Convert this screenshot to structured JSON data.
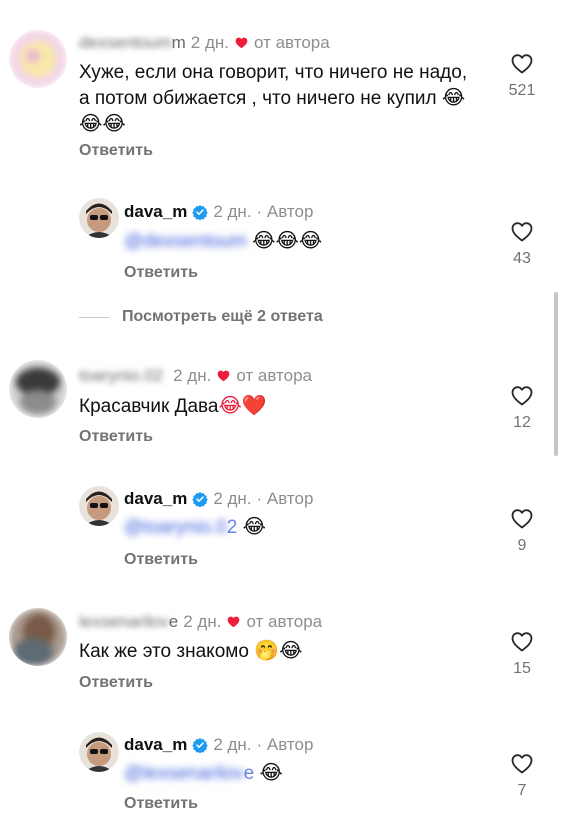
{
  "colors": {
    "accent_red": "#ed1d3c",
    "meta_gray": "#8e8e8e",
    "verified_blue": "#1d9bf0"
  },
  "icons": {
    "like": "heart-outline-icon",
    "author_liked": "red-heart-icon",
    "verified": "verified-badge-icon"
  },
  "comments": [
    {
      "username": "m",
      "time": "2 дн.",
      "author_like": "от автора",
      "text": "Хуже, если она говорит, что ничего не надо, а потом обижается , что ничего не купил",
      "emoji": "😂😂😂",
      "reply_label": "Ответить",
      "likes": "521"
    },
    {
      "username": "dava_m",
      "time": "2 дн.",
      "author_tag": "· Автор",
      "mention": "@",
      "emoji": "😂😂😂",
      "reply_label": "Ответить",
      "likes": "43"
    },
    {
      "more_replies": "Посмотреть ещё 2 ответа"
    },
    {
      "username": "",
      "time": "2 дн.",
      "author_like": "от автора",
      "text": "Красавчик Дава",
      "emoji": "😂❤️",
      "reply_label": "Ответить",
      "likes": "12"
    },
    {
      "username": "dava_m",
      "time": "2 дн.",
      "author_tag": "· Автор",
      "mention": "@",
      "mention_tail": "2",
      "emoji": "😂",
      "reply_label": "Ответить",
      "likes": "9"
    },
    {
      "username": "e",
      "time": "2 дн.",
      "author_like": "от автора",
      "text": "Как же это знакомо",
      "emoji": "🤭😂",
      "reply_label": "Ответить",
      "likes": "15"
    },
    {
      "username": "dava_m",
      "time": "2 дн.",
      "author_tag": "· Автор",
      "mention": "@",
      "mention_tail": "e",
      "emoji": "😂",
      "reply_label": "Ответить",
      "likes": "7"
    }
  ]
}
